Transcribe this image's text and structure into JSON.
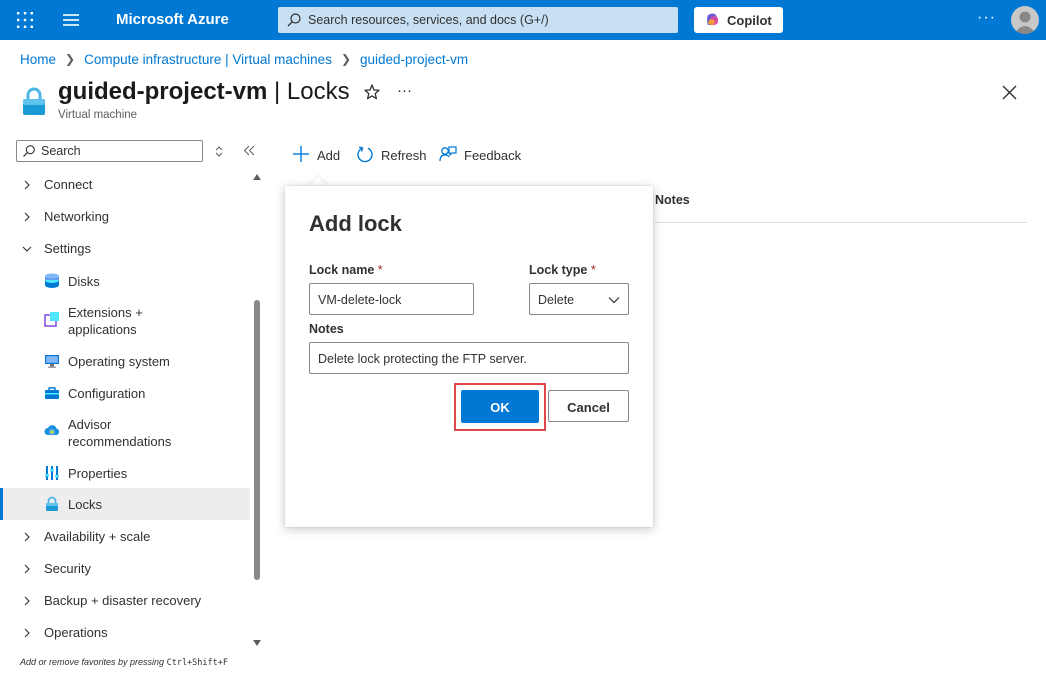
{
  "topbar": {
    "brand": "Microsoft Azure",
    "search_placeholder": "Search resources, services, and docs (G+/)",
    "copilot_label": "Copilot",
    "more": "···",
    "accent": "#0078d4"
  },
  "breadcrumb": {
    "items": [
      "Home",
      "Compute infrastructure | Virtual machines",
      "guided-project-vm"
    ]
  },
  "header": {
    "resource_name": "guided-project-vm",
    "blade_name": "| Locks",
    "subtitle": "Virtual machine",
    "more": "···"
  },
  "sidebar": {
    "search_placeholder": "Search",
    "items": [
      {
        "label": "Connect",
        "type": "group",
        "expanded": false
      },
      {
        "label": "Networking",
        "type": "group",
        "expanded": false
      },
      {
        "label": "Settings",
        "type": "group",
        "expanded": true
      },
      {
        "label": "Disks",
        "type": "child",
        "icon": "disks-icon"
      },
      {
        "label": "Extensions +",
        "label2": "applications",
        "type": "child",
        "icon": "extensions-icon"
      },
      {
        "label": "Operating system",
        "type": "child",
        "icon": "monitor-icon"
      },
      {
        "label": "Configuration",
        "type": "child",
        "icon": "toolbox-icon"
      },
      {
        "label": "Advisor",
        "label2": "recommendations",
        "type": "child",
        "icon": "advisor-icon"
      },
      {
        "label": "Properties",
        "type": "child",
        "icon": "properties-icon"
      },
      {
        "label": "Locks",
        "type": "child",
        "icon": "lock-icon",
        "active": true
      },
      {
        "label": "Availability + scale",
        "type": "group",
        "expanded": false
      },
      {
        "label": "Security",
        "type": "group",
        "expanded": false
      },
      {
        "label": "Backup + disaster recovery",
        "type": "group",
        "expanded": false
      },
      {
        "label": "Operations",
        "type": "group",
        "expanded": false
      }
    ],
    "hint_prefix": "Add or remove favorites by pressing",
    "hint_keys": "Ctrl+Shift+F"
  },
  "toolbar": {
    "add_label": "Add",
    "refresh_label": "Refresh",
    "feedback_label": "Feedback"
  },
  "table": {
    "columns": [
      "Notes"
    ]
  },
  "dialog": {
    "title": "Add lock",
    "lock_name_label": "Lock name",
    "lock_name_value": "VM-delete-lock",
    "lock_type_label": "Lock type",
    "lock_type_value": "Delete",
    "required_mark": "*",
    "notes_label": "Notes",
    "notes_value": "Delete lock protecting the FTP server.",
    "ok_label": "OK",
    "cancel_label": "Cancel"
  }
}
